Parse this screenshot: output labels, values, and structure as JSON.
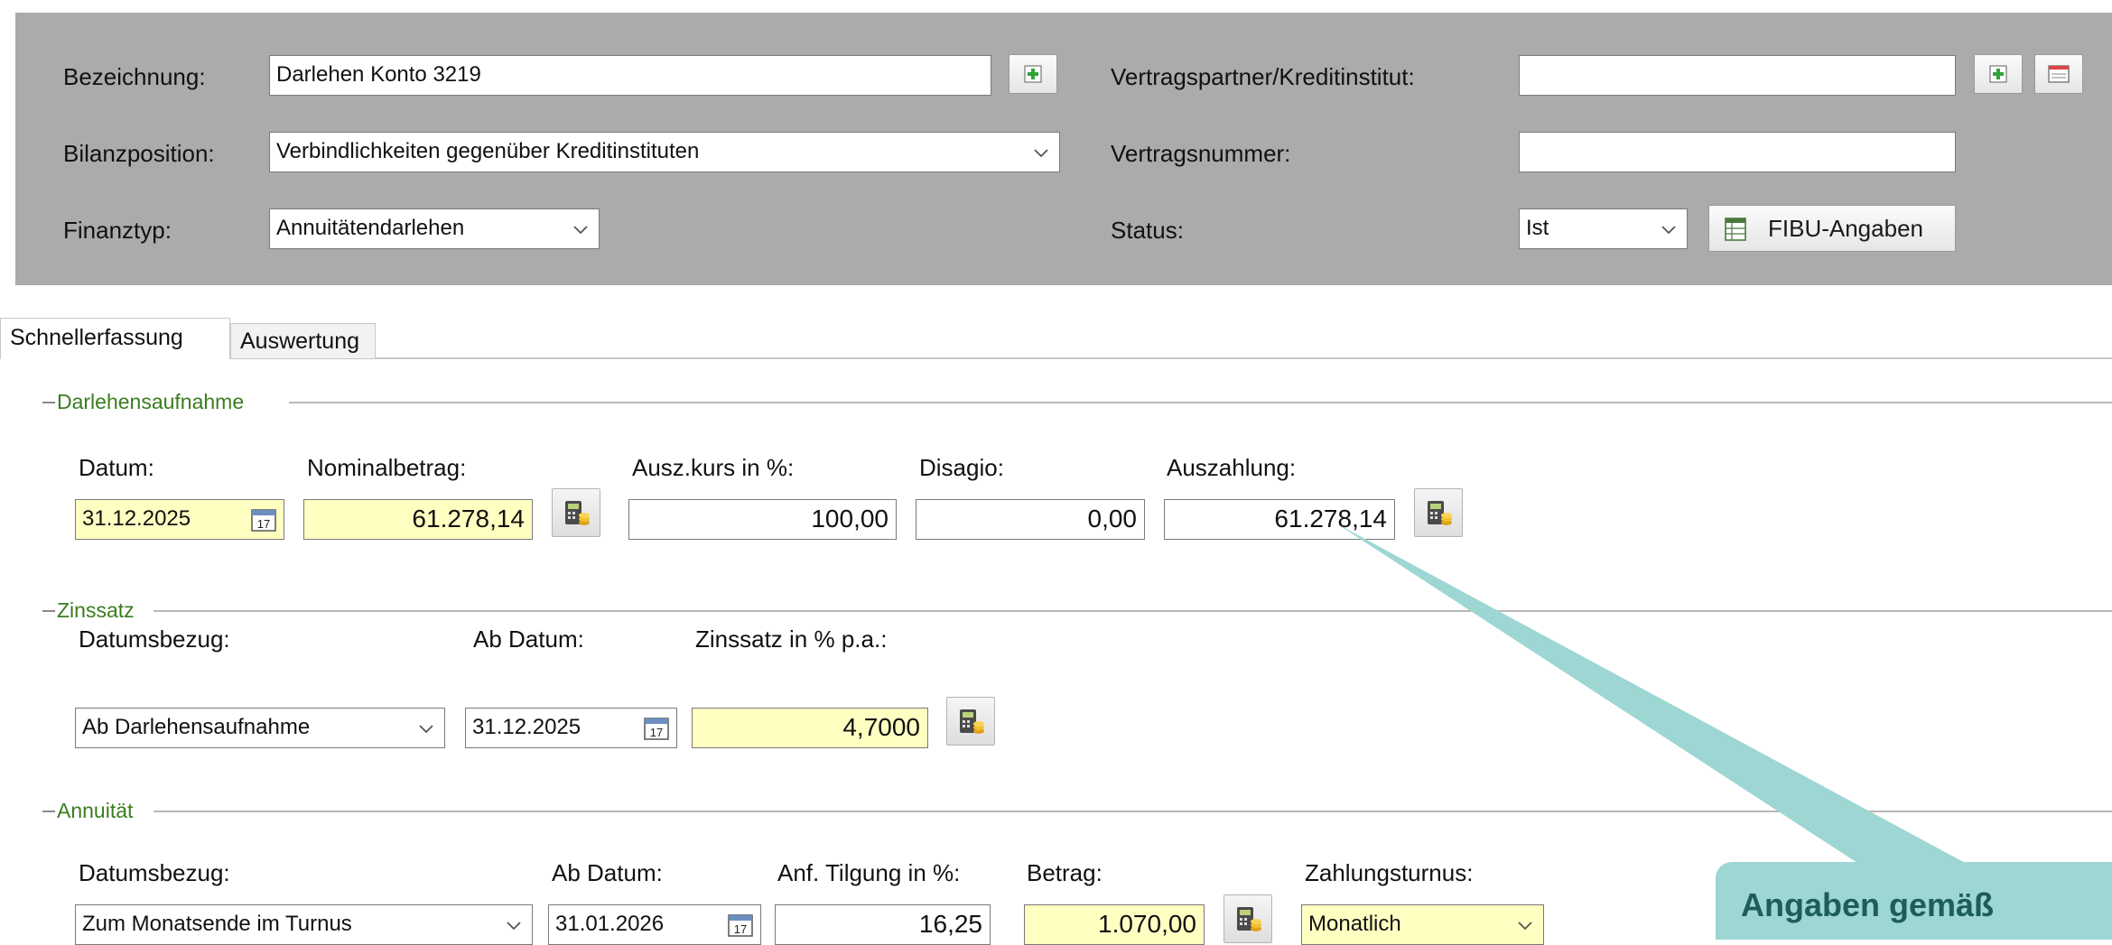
{
  "header": {
    "bezeichnung_label": "Bezeichnung:",
    "bezeichnung_value": "Darlehen Konto 3219",
    "bilanzposition_label": "Bilanzposition:",
    "bilanzposition_value": "Verbindlichkeiten gegenüber Kreditinstituten",
    "finanztyp_label": "Finanztyp:",
    "finanztyp_value": "Annuitätendarlehen",
    "vertragspartner_label": "Vertragspartner/Kreditinstitut:",
    "vertragspartner_value": "",
    "vertragsnummer_label": "Vertragsnummer:",
    "vertragsnummer_value": "",
    "status_label": "Status:",
    "status_value": "Ist",
    "fibu_button_label": "FIBU-Angaben"
  },
  "tabs": [
    {
      "label": "Schnellerfassung",
      "active": true
    },
    {
      "label": "Auswertung",
      "active": false
    }
  ],
  "darlehensaufnahme": {
    "title": "Darlehensaufnahme",
    "datum_label": "Datum:",
    "datum_value": "31.12.2025",
    "nominalbetrag_label": "Nominalbetrag:",
    "nominalbetrag_value": "61.278,14",
    "auszkurs_label": "Ausz.kurs in %:",
    "auszkurs_value": "100,00",
    "disagio_label": "Disagio:",
    "disagio_value": "0,00",
    "auszahlung_label": "Auszahlung:",
    "auszahlung_value": "61.278,14"
  },
  "zinssatz": {
    "title": "Zinssatz",
    "datumsbezug_label": "Datumsbezug:",
    "datumsbezug_value": "Ab Darlehensaufnahme",
    "abdatum_label": "Ab Datum:",
    "abdatum_value": "31.12.2025",
    "zinssatz_label": "Zinssatz in % p.a.:",
    "zinssatz_value": "4,7000"
  },
  "annuitaet": {
    "title": "Annuität",
    "datumsbezug_label": "Datumsbezug:",
    "datumsbezug_value": "Zum Monatsende im Turnus",
    "abdatum_label": "Ab Datum:",
    "abdatum_value": "31.01.2026",
    "tilgung_label": "Anf. Tilgung in %:",
    "tilgung_value": "16,25",
    "betrag_label": "Betrag:",
    "betrag_value": "1.070,00",
    "turnus_label": "Zahlungsturnus:",
    "turnus_value": "Monatlich"
  },
  "callout": {
    "text": "Angaben gemäß",
    "color": "#9dd6d3",
    "text_color": "#1d5d5a"
  },
  "colors": {
    "header_bg": "#ababab",
    "highlight_field": "#ffffc2",
    "group_title": "#3a7d1e"
  },
  "icons": {
    "add": "plus-icon",
    "calendar": "calendar-icon",
    "calculator": "calculator-icon",
    "fibu": "spreadsheet-icon",
    "window": "window-icon"
  }
}
